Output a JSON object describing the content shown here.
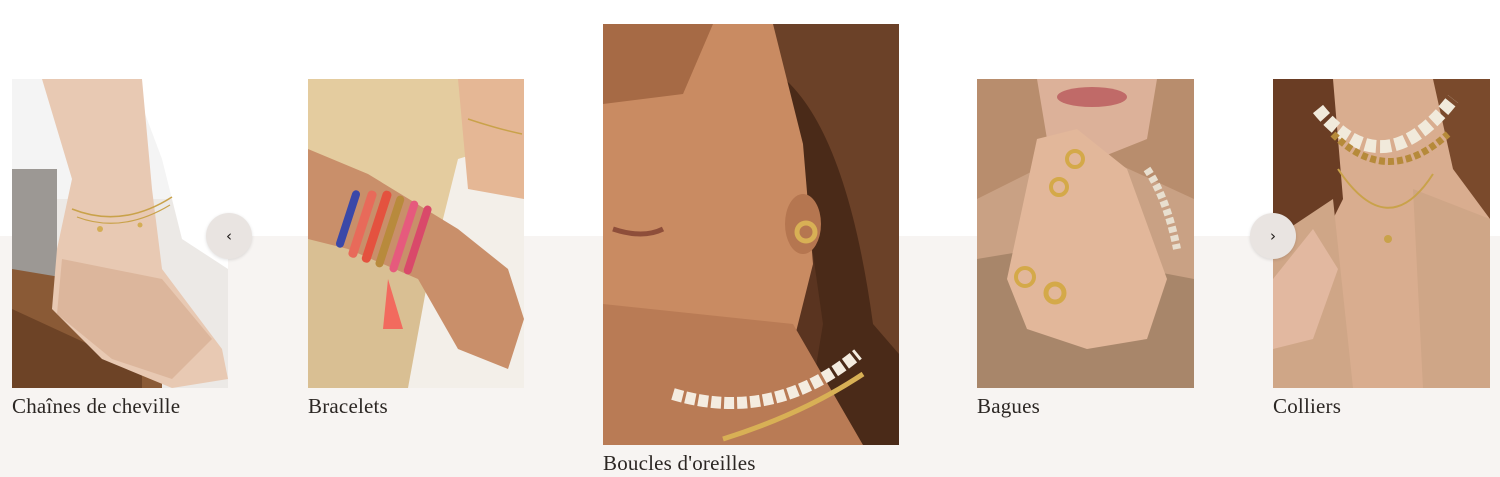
{
  "carousel": {
    "prev_icon": "‹",
    "next_icon": "›",
    "items": [
      {
        "label": "Chaînes de cheville",
        "image": "anklet-photo"
      },
      {
        "label": "Bracelets",
        "image": "bracelets-photo"
      },
      {
        "label": "Boucles d'oreilles",
        "image": "earrings-photo"
      },
      {
        "label": "Bagues",
        "image": "rings-photo"
      },
      {
        "label": "Colliers",
        "image": "necklaces-photo"
      }
    ]
  },
  "colors": {
    "band": "#f7f4f2",
    "text": "#2b2623",
    "nav_bg": "#e9e4e1",
    "gold": "#c9a24a"
  }
}
